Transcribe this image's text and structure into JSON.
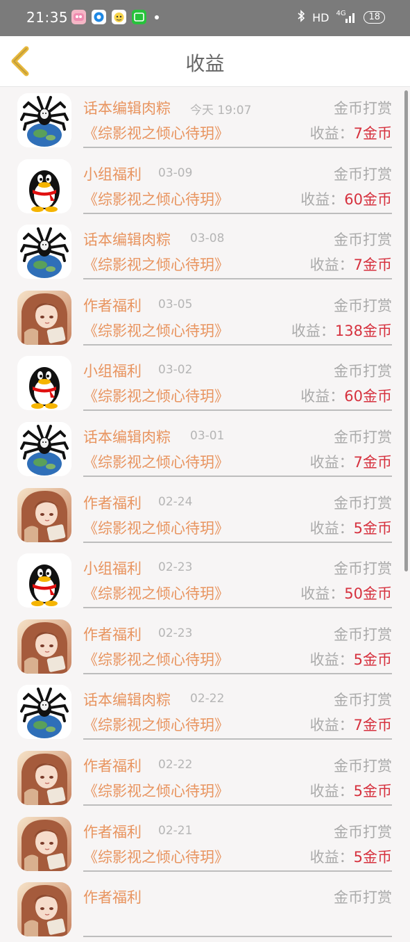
{
  "status_bar": {
    "time": "21:35",
    "network": "HD",
    "signal_type": "4G",
    "battery": "18",
    "app_icons": [
      "pink-app-icon",
      "blue-circle-app-icon",
      "cartoon-face-app-icon",
      "iqiyi-app-icon"
    ]
  },
  "header": {
    "title": "收益"
  },
  "colors": {
    "name": "#e8945f",
    "income_value": "#d6313e",
    "muted": "#aaaaaa"
  },
  "list": {
    "items": [
      {
        "name": "话本编辑肉粽",
        "date": "今天 19:07",
        "type": "金币打赏",
        "book": "《综影视之倾心待玥》",
        "income_label": "收益：",
        "income_value": "7金币",
        "avatar": "spider-globe-avatar"
      },
      {
        "name": "小组福利",
        "date": "03-09",
        "type": "金币打赏",
        "book": "《综影视之倾心待玥》",
        "income_label": "收益：",
        "income_value": "60金币",
        "avatar": "qq-penguin-avatar"
      },
      {
        "name": "话本编辑肉粽",
        "date": "03-08",
        "type": "金币打赏",
        "book": "《综影视之倾心待玥》",
        "income_label": "收益：",
        "income_value": "7金币",
        "avatar": "spider-globe-avatar"
      },
      {
        "name": "作者福利",
        "date": "03-05",
        "type": "金币打赏",
        "book": "《综影视之倾心待玥》",
        "income_label": "收益：",
        "income_value": "138金币",
        "avatar": "anime-girl-avatar"
      },
      {
        "name": "小组福利",
        "date": "03-02",
        "type": "金币打赏",
        "book": "《综影视之倾心待玥》",
        "income_label": "收益：",
        "income_value": "60金币",
        "avatar": "qq-penguin-avatar"
      },
      {
        "name": "话本编辑肉粽",
        "date": "03-01",
        "type": "金币打赏",
        "book": "《综影视之倾心待玥》",
        "income_label": "收益：",
        "income_value": "7金币",
        "avatar": "spider-globe-avatar"
      },
      {
        "name": "作者福利",
        "date": "02-24",
        "type": "金币打赏",
        "book": "《综影视之倾心待玥》",
        "income_label": "收益：",
        "income_value": "5金币",
        "avatar": "anime-girl-avatar"
      },
      {
        "name": "小组福利",
        "date": "02-23",
        "type": "金币打赏",
        "book": "《综影视之倾心待玥》",
        "income_label": "收益：",
        "income_value": "50金币",
        "avatar": "qq-penguin-avatar"
      },
      {
        "name": "作者福利",
        "date": "02-23",
        "type": "金币打赏",
        "book": "《综影视之倾心待玥》",
        "income_label": "收益：",
        "income_value": "5金币",
        "avatar": "anime-girl-avatar"
      },
      {
        "name": "话本编辑肉粽",
        "date": "02-22",
        "type": "金币打赏",
        "book": "《综影视之倾心待玥》",
        "income_label": "收益：",
        "income_value": "7金币",
        "avatar": "spider-globe-avatar"
      },
      {
        "name": "作者福利",
        "date": "02-22",
        "type": "金币打赏",
        "book": "《综影视之倾心待玥》",
        "income_label": "收益：",
        "income_value": "5金币",
        "avatar": "anime-girl-avatar"
      },
      {
        "name": "作者福利",
        "date": "02-21",
        "type": "金币打赏",
        "book": "《综影视之倾心待玥》",
        "income_label": "收益：",
        "income_value": "5金币",
        "avatar": "anime-girl-avatar"
      },
      {
        "name": "作者福利",
        "date": "",
        "type": "金币打赏",
        "book": "",
        "income_label": "",
        "income_value": "",
        "avatar": "anime-girl-avatar"
      }
    ]
  }
}
